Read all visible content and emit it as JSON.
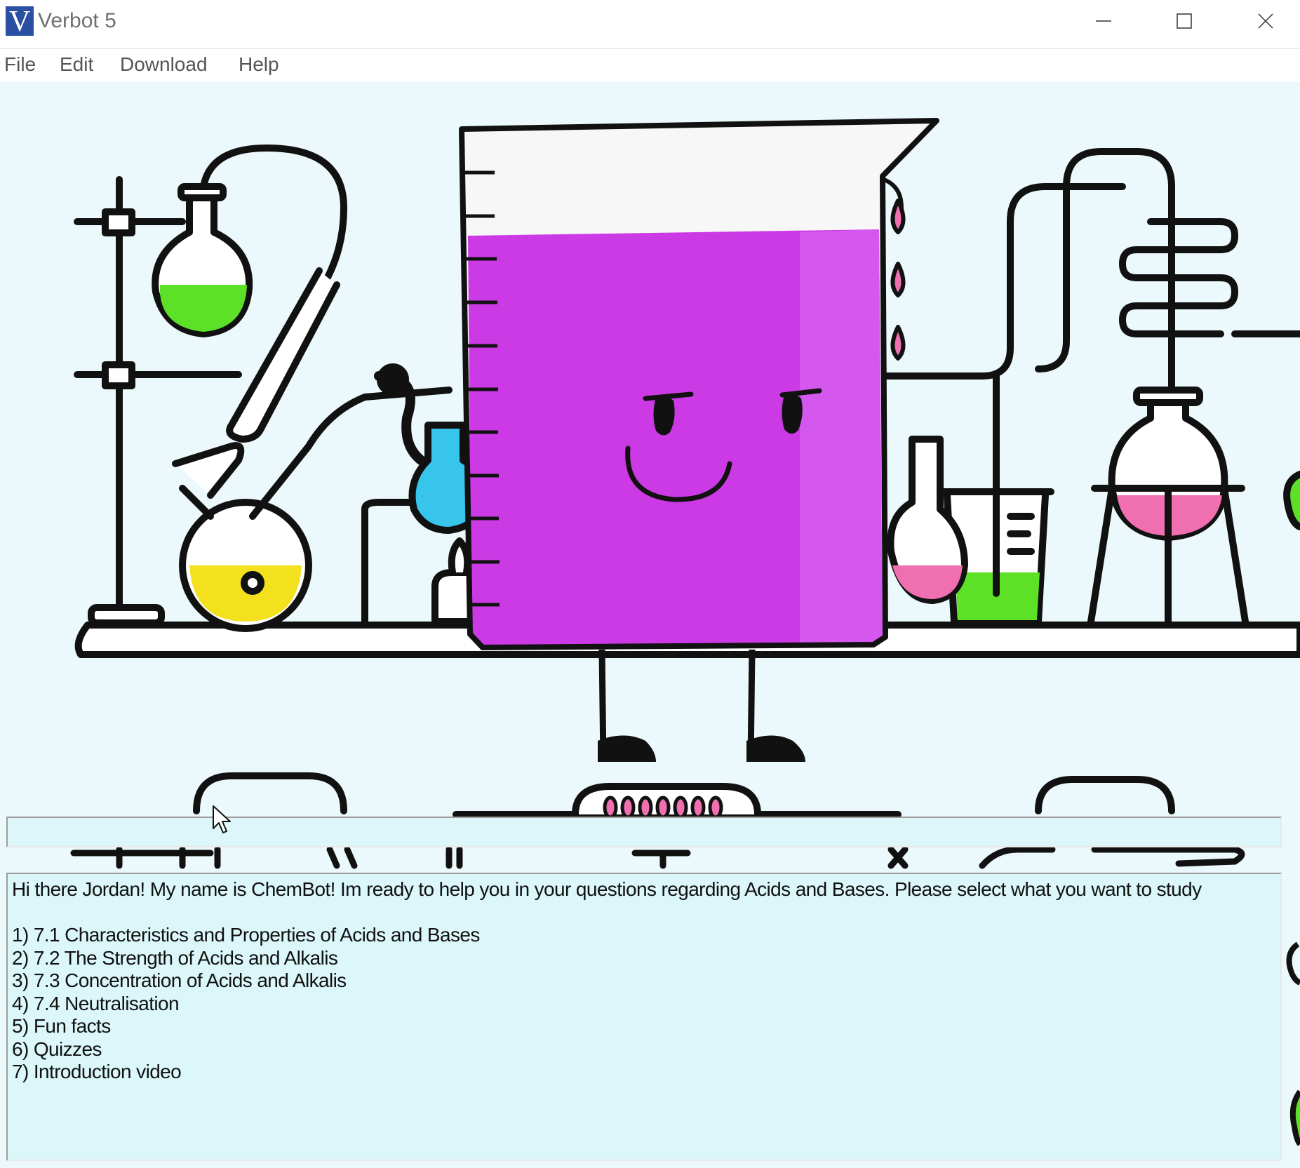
{
  "window": {
    "title": "Verbot 5",
    "logo_letter": "V",
    "controls": [
      "minimize",
      "maximize",
      "close"
    ]
  },
  "menu": {
    "items": [
      "File",
      "Edit",
      "Download",
      "Help"
    ]
  },
  "input": {
    "value": ""
  },
  "output": {
    "greeting": "Hi there Jordan! My name is ChemBot! Im ready to help you in your questions regarding Acids and Bases. Please select what you want to study",
    "options": [
      "1) 7.1 Characteristics and Properties of Acids and Bases",
      "2) 7.2 The Strength of Acids and Alkalis",
      "3) 7.3 Concentration of Acids and Alkalis",
      "4) 7.4 Neutralisation",
      "5) Fun facts",
      "6) Quizzes",
      "7) Introduction video"
    ]
  },
  "colors": {
    "beaker_liquid": "#cc3ae6",
    "green_liquid": "#5de126",
    "yellow_liquid": "#f3e11e",
    "blue_liquid": "#37c5ec",
    "pink_liquid": "#f06fb0",
    "outline": "#111111",
    "background": "#ecf9fc",
    "text_box": "#dcf7fa"
  },
  "icons": {
    "app": "verbot-logo-icon",
    "minimize": "minimize-icon",
    "maximize": "maximize-icon",
    "close": "close-icon",
    "cursor": "mouse-pointer-icon",
    "character": "beaker-character"
  }
}
